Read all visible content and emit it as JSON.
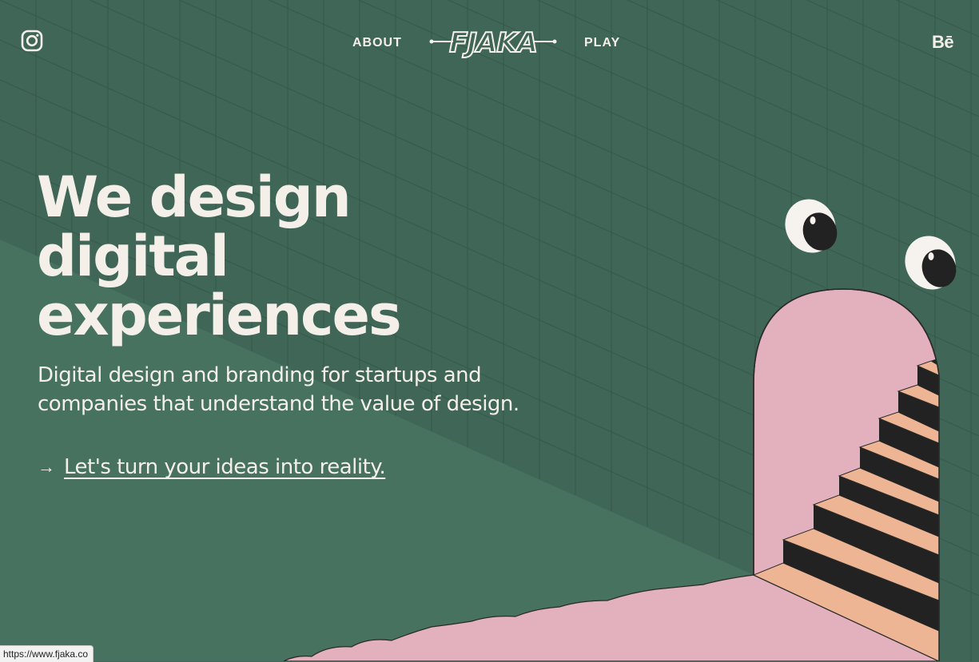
{
  "colors": {
    "background": "#3f6657",
    "background_light": "#47725f",
    "grid_line": "#365a4b",
    "text": "#f4efe9",
    "pink": "#e3b0bd",
    "peach": "#eeb594",
    "stair_dark": "#222222"
  },
  "header": {
    "instagram_icon": "instagram-icon",
    "nav_about": "ABOUT",
    "logo_text": "FJAKA",
    "nav_play": "PLAY",
    "behance_label": "Bē"
  },
  "hero": {
    "title_line1": "We design",
    "title_line2": "digital",
    "title_line3": "experiences",
    "subtitle_line1": "Digital design and branding for startups and",
    "subtitle_line2": "companies that understand the value of design.",
    "cta_arrow": "→",
    "cta_label": "Let's turn your ideas into reality."
  },
  "illustration": {
    "eyes_icon": "eyes-icon",
    "doorway_icon": "doorway-stairs-icon"
  },
  "status_bar": {
    "url": "https://www.fjaka.co"
  }
}
